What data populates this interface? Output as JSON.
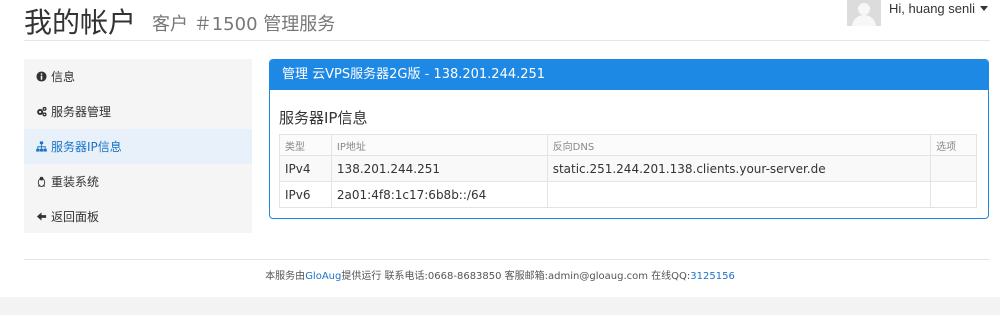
{
  "header": {
    "title": "我的帐户",
    "subtitle": "客户 ＃1500 管理服务",
    "user_greeting": "Hi, huang senli"
  },
  "sidebar": {
    "items": [
      {
        "label": "信息",
        "icon": "info-icon"
      },
      {
        "label": "服务器管理",
        "icon": "cogs-icon"
      },
      {
        "label": "服务器IP信息",
        "icon": "sitemap-icon",
        "active": true
      },
      {
        "label": "重装系统",
        "icon": "linux-icon"
      },
      {
        "label": "返回面板",
        "icon": "arrow-left-icon"
      }
    ]
  },
  "panel": {
    "heading": "管理 云VPS服务器2G版 - 138.201.244.251",
    "section_title": "服务器IP信息",
    "columns": [
      "类型",
      "IP地址",
      "反向DNS",
      "选项"
    ],
    "rows": [
      {
        "type": "IPv4",
        "ip": "138.201.244.251",
        "rdns": "static.251.244.201.138.clients.your-server.de",
        "options": ""
      },
      {
        "type": "IPv6",
        "ip": "2a01:4f8:1c17:6b8b::/64",
        "rdns": "",
        "options": ""
      }
    ]
  },
  "footer": {
    "prefix": "本服务由",
    "provider_link": "GloAug",
    "middle": "提供运行 联系电话:0668-8683850 客服邮箱:admin@gloaug.com 在线QQ:",
    "qq_link": "3125156"
  },
  "colors": {
    "accent": "#1e88e5",
    "active_bg": "#e8f1fa",
    "link": "#1a73c7"
  }
}
